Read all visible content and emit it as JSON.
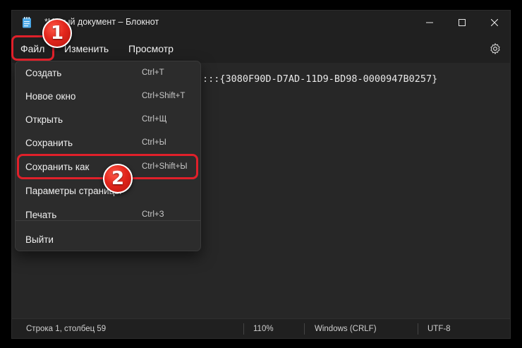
{
  "window": {
    "title": "*Новый документ – Блокнот"
  },
  "menubar": {
    "file": "Файл",
    "edit": "Изменить",
    "view": "Просмотр"
  },
  "editor": {
    "text": ":::{3080F90D-D7AD-11D9-BD98-0000947B0257}"
  },
  "file_menu": {
    "items": [
      {
        "label": "Создать",
        "shortcut": "Ctrl+T"
      },
      {
        "label": "Новое окно",
        "shortcut": "Ctrl+Shift+T"
      },
      {
        "label": "Открыть",
        "shortcut": "Ctrl+Щ"
      },
      {
        "label": "Сохранить",
        "shortcut": "Ctrl+Ы"
      },
      {
        "label": "Сохранить как",
        "shortcut": "Ctrl+Shift+Ы"
      },
      {
        "label": "Параметры страницы",
        "shortcut": ""
      },
      {
        "label": "Печать",
        "shortcut": "Ctrl+З"
      },
      {
        "label": "Выйти",
        "shortcut": ""
      }
    ]
  },
  "statusbar": {
    "position": "Строка 1, столбец 59",
    "zoom": "110%",
    "line_endings": "Windows (CRLF)",
    "encoding": "UTF-8"
  },
  "annotations": {
    "step1": "1",
    "step2": "2"
  },
  "colors": {
    "accent_red": "#e0202a",
    "background": "#1f1f1f"
  }
}
